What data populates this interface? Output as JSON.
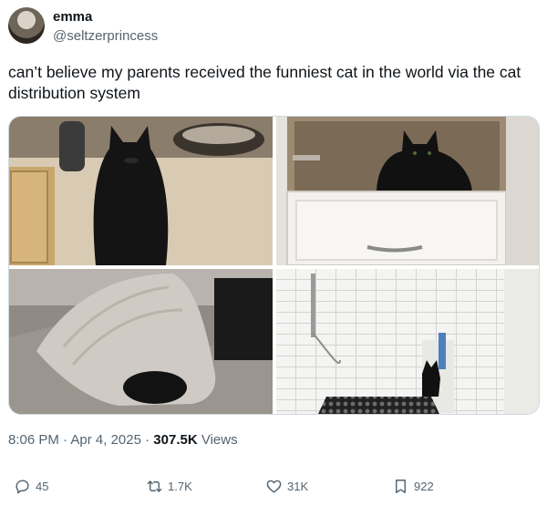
{
  "author": {
    "name": "emma",
    "handle": "@seltzerprincess"
  },
  "tweet": {
    "text": "can’t believe my parents received the funniest cat in the world via the cat distribution system"
  },
  "media": [
    {
      "icon": "photo-cat-on-counter"
    },
    {
      "icon": "photo-cat-in-cabinet"
    },
    {
      "icon": "photo-cat-under-rug"
    },
    {
      "icon": "photo-cat-in-shower"
    }
  ],
  "meta": {
    "time": "8:06 PM",
    "sep1": "·",
    "date": "Apr 4, 2025",
    "sep2": "·",
    "views_count": "307.5K",
    "views_label": "Views"
  },
  "actions": {
    "replies": "45",
    "reposts": "1.7K",
    "likes": "31K",
    "bookmarks": "922"
  },
  "colors": {
    "text": "#0f1419",
    "secondary": "#536471",
    "border": "#cfd9de"
  }
}
